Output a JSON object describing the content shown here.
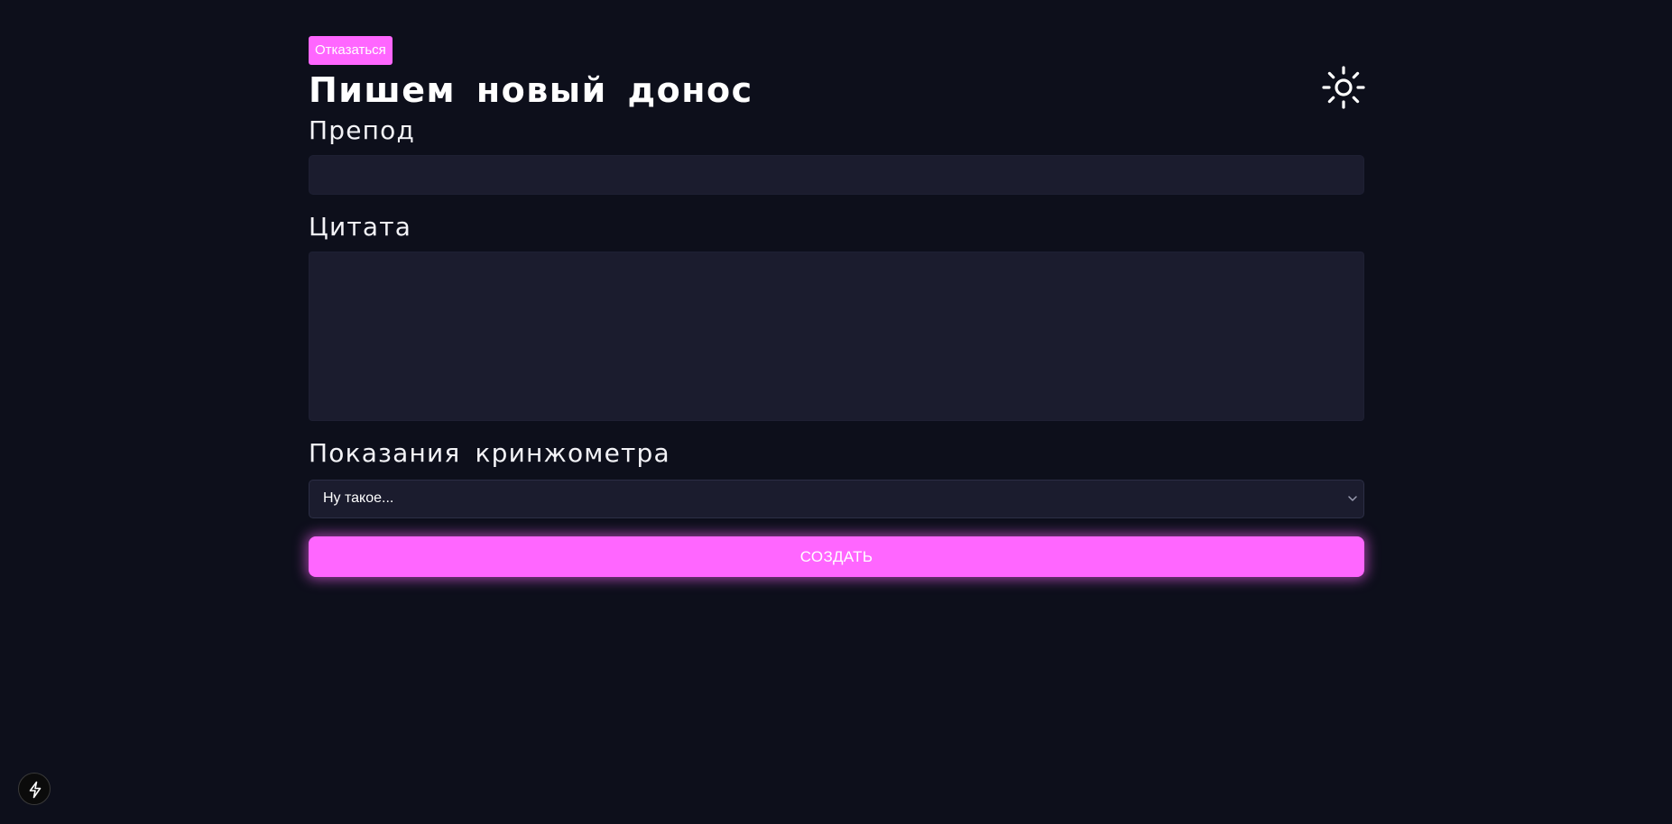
{
  "header": {
    "cancel_label": "Отказаться",
    "title": "Пишем новый донос",
    "theme_icon": "sun-icon"
  },
  "form": {
    "teacher": {
      "label": "Препод",
      "value": "",
      "placeholder": ""
    },
    "quote": {
      "label": "Цитата",
      "value": "",
      "placeholder": ""
    },
    "cringe": {
      "label": "Показания кринжометра",
      "selected": "Ну такое...",
      "icon": "chevron-down-icon"
    },
    "submit_label": "СОЗДАТЬ"
  },
  "devtools": {
    "icon": "lightning-bolt-icon"
  },
  "colors": {
    "background": "#0d0f1b",
    "accent": "#ff66ff",
    "field": "#1b1c2e"
  }
}
